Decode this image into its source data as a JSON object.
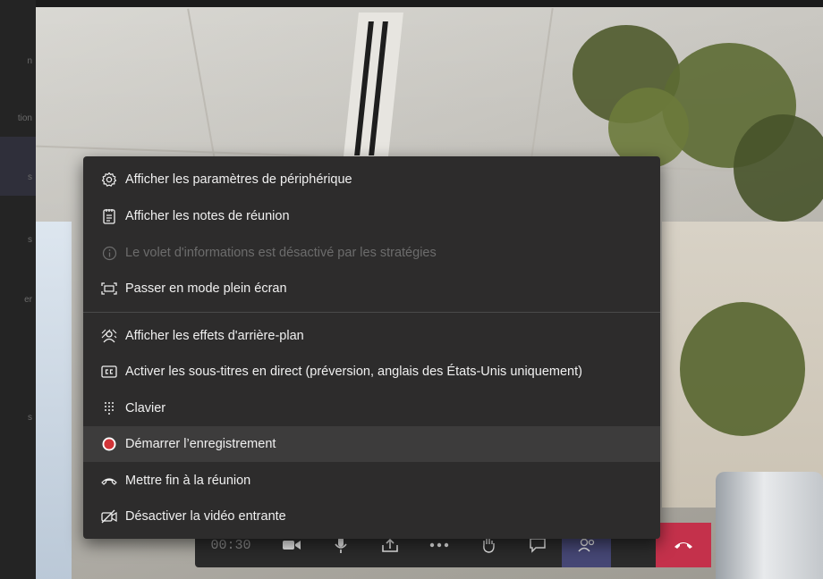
{
  "rail": {
    "fragments": [
      "n",
      "tion",
      "s",
      "s",
      "er",
      "s"
    ]
  },
  "menu": {
    "items": [
      {
        "label": "Afficher les paramètres de périphérique",
        "icon": "gear-icon",
        "enabled": true
      },
      {
        "label": "Afficher les notes de réunion",
        "icon": "notes-icon",
        "enabled": true
      },
      {
        "label": "Le volet d'informations est désactivé par les stratégies",
        "icon": "info-icon",
        "enabled": false
      },
      {
        "label": "Passer en mode plein écran",
        "icon": "fullscreen-icon",
        "enabled": true
      },
      {
        "label": "Afficher les effets d'arrière-plan",
        "icon": "background-effects-icon",
        "enabled": true
      },
      {
        "label": "Activer les sous-titres en direct (préversion, anglais des États-Unis uniquement)",
        "icon": "captions-icon",
        "enabled": true
      },
      {
        "label": "Clavier",
        "icon": "dialpad-icon",
        "enabled": true
      },
      {
        "label": "Démarrer l’enregistrement",
        "icon": "record-icon",
        "enabled": true,
        "highlighted": true
      },
      {
        "label": "Mettre fin à la réunion",
        "icon": "end-meeting-icon",
        "enabled": true
      },
      {
        "label": "Désactiver la vidéo entrante",
        "icon": "video-off-icon",
        "enabled": true
      }
    ]
  },
  "controlbar": {
    "timer": "00:30",
    "buttons": [
      "camera-icon",
      "microphone-icon",
      "share-icon",
      "more-icon",
      "raise-hand-icon",
      "chat-icon",
      "participants-icon",
      "hang-up-icon"
    ]
  },
  "colors": {
    "menu_bg": "#2d2c2c",
    "accent": "#464775",
    "hangup": "#c4314b",
    "record": "#d13438"
  }
}
